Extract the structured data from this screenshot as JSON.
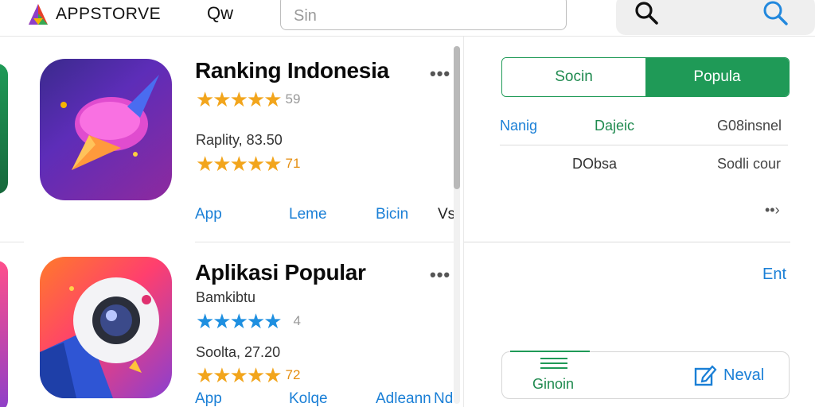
{
  "header": {
    "logo_text": "APPSTORVE",
    "nav_label": "Qw",
    "search_placeholder": "Sin"
  },
  "cards": [
    {
      "title": "Ranking Indonesia",
      "more": "•••",
      "rating_top": "59",
      "subtitle": "Raplity, 83.50",
      "rating_bottom": "71",
      "links": [
        "App",
        "Leme",
        "Bicin",
        "Vs"
      ]
    },
    {
      "title": "Aplikasi Popular",
      "more": "•••",
      "subtitle_top": "Bamkibtu",
      "rating_top": "4",
      "subtitle": "Soolta, 27.20",
      "rating_bottom": "72",
      "links": [
        "App",
        "Kolqe",
        "Adleann",
        "Nd"
      ]
    }
  ],
  "right": {
    "seg_left": "Socin",
    "seg_right": "Popula",
    "row1": [
      "Nanig",
      "Dajeic",
      "G08insnel"
    ],
    "row2": [
      "DObsa",
      "Sodli cour"
    ],
    "more_arrow": "••›",
    "link": "Ent",
    "bottom_left": "Ginoin",
    "bottom_right": "Neval"
  },
  "colors": {
    "accent_green": "#1f9a57",
    "link_blue": "#1a7fd6",
    "star_gold": "#f2a51c",
    "star_blue": "#1e8fe0"
  },
  "icons": [
    "logo-icon",
    "search-icon",
    "search-icon-blue",
    "edit-icon",
    "menu-icon"
  ]
}
